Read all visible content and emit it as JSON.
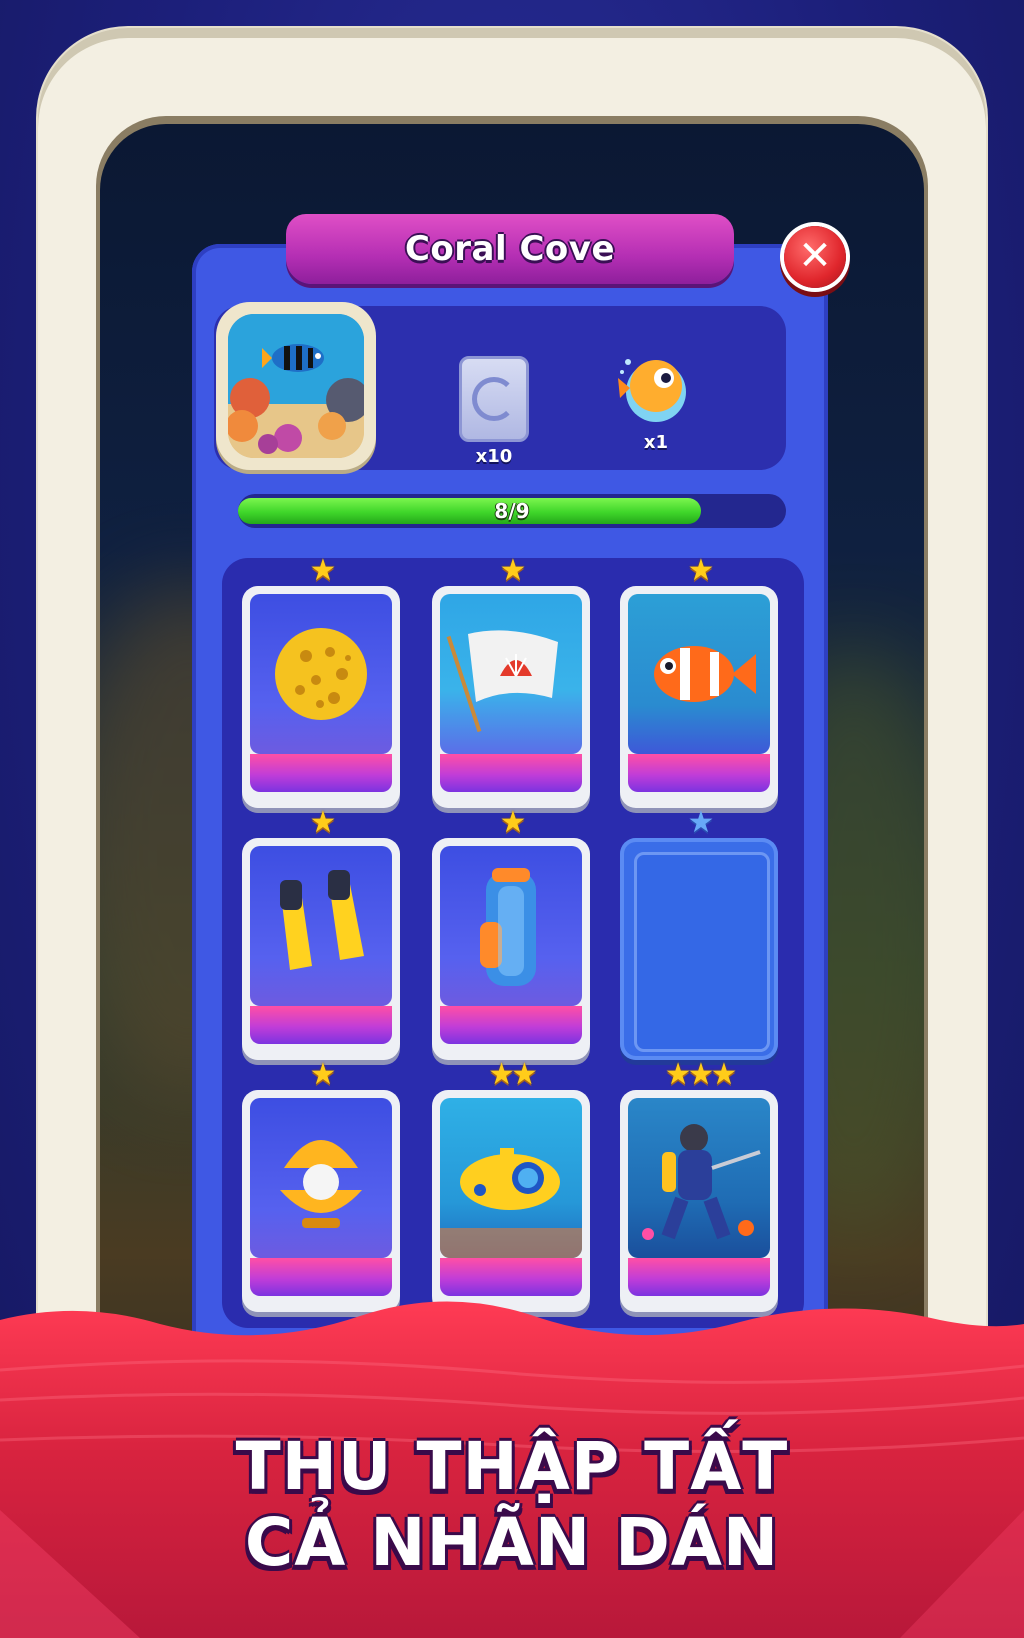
{
  "album": {
    "title": "Coral Cove",
    "close_icon": "close-icon"
  },
  "rewards": [
    {
      "icon": "card-pack-icon",
      "qty": "x10"
    },
    {
      "icon": "pufferfish-icon",
      "qty": "x1"
    }
  ],
  "progress": {
    "label": "8/9",
    "fraction": 0.889
  },
  "cards": [
    {
      "icon": "sea-sponge-icon",
      "stars": 1,
      "collected": true
    },
    {
      "icon": "shell-flag-icon",
      "stars": 1,
      "collected": true
    },
    {
      "icon": "clownfish-icon",
      "stars": 1,
      "collected": true
    },
    {
      "icon": "flippers-icon",
      "stars": 1,
      "collected": true
    },
    {
      "icon": "golf-bag-icon",
      "stars": 1,
      "collected": true
    },
    {
      "icon": "empty-slot-icon",
      "stars": 1,
      "collected": false
    },
    {
      "icon": "pearl-golf-ball-icon",
      "stars": 1,
      "collected": true
    },
    {
      "icon": "submarine-icon",
      "stars": 2,
      "collected": true
    },
    {
      "icon": "diver-golfer-icon",
      "stars": 3,
      "collected": true
    }
  ],
  "promo": {
    "line1": "THU THẬP TẤT",
    "line2": "CẢ NHÃN DÁN"
  },
  "colors": {
    "panel": "#3f58e4",
    "title_banner": "#c23cbc",
    "progress_fill": "#3fd62a",
    "close_button": "#e0262c",
    "promo_wave": "#d8233f"
  }
}
